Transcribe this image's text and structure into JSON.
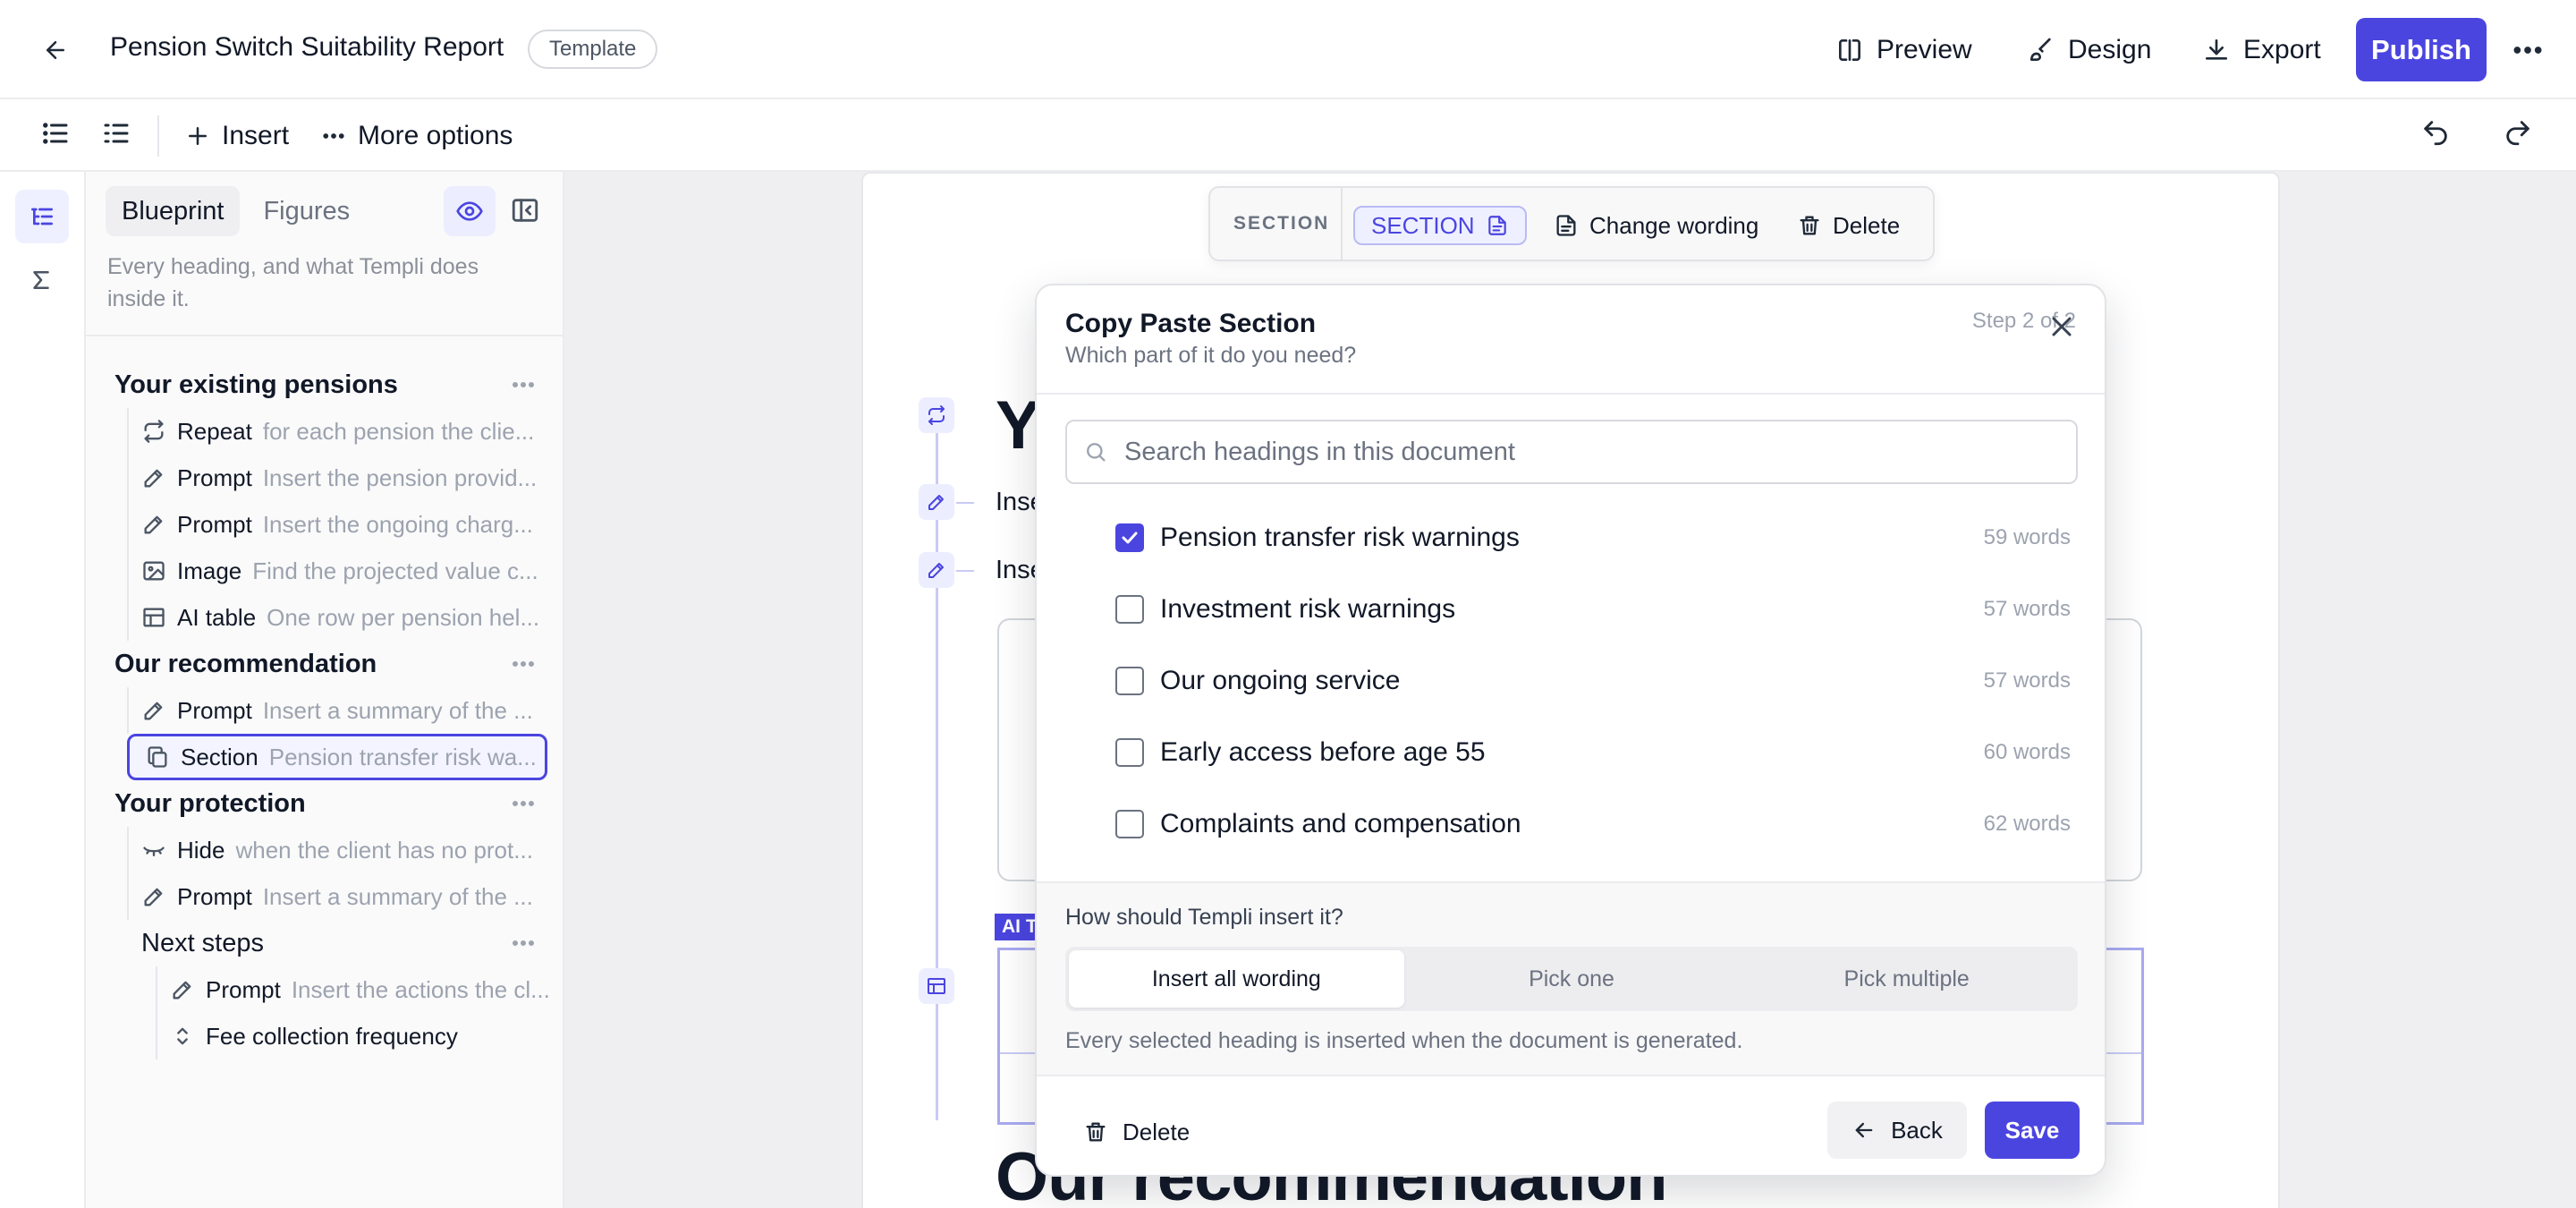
{
  "header": {
    "title": "Pension Switch Suitability Report",
    "badge": "Template",
    "actions": {
      "preview": "Preview",
      "design": "Design",
      "export": "Export",
      "publish": "Publish"
    }
  },
  "toolbar": {
    "insert": "Insert",
    "more_options": "More options"
  },
  "sidebar": {
    "tabs": [
      "Blueprint",
      "Figures"
    ],
    "description": "Every heading, and what Templi does inside it.",
    "sections": [
      {
        "title": "Your existing pensions",
        "blocks": [
          {
            "icon": "repeat-icon",
            "name": "Repeat",
            "desc": "for each pension the clie..."
          },
          {
            "icon": "pencil-icon",
            "name": "Prompt",
            "desc": "Insert the pension provid..."
          },
          {
            "icon": "pencil-icon",
            "name": "Prompt",
            "desc": "Insert the ongoing charg..."
          },
          {
            "icon": "image-icon",
            "name": "Image",
            "desc": "Find the projected value c..."
          },
          {
            "icon": "table-icon",
            "name": "AI table",
            "desc": "One row per pension hel..."
          }
        ]
      },
      {
        "title": "Our recommendation",
        "blocks": [
          {
            "icon": "pencil-icon",
            "name": "Prompt",
            "desc": "Insert a summary of the ..."
          },
          {
            "icon": "copy-icon",
            "name": "Section",
            "desc": "Pension transfer risk wa..."
          }
        ]
      },
      {
        "title": "Your protection",
        "blocks": [
          {
            "icon": "eye-closed-icon",
            "name": "Hide",
            "desc": "when the client has no prot..."
          },
          {
            "icon": "pencil-icon",
            "name": "Prompt",
            "desc": "Insert a summary of the ..."
          }
        ]
      },
      {
        "title": "Next steps",
        "blocks": [
          {
            "icon": "pencil-icon",
            "name": "Prompt",
            "desc": "Insert the actions the cl..."
          },
          {
            "icon": "chevron-updown-icon",
            "name": "Fee collection frequency",
            "desc": ""
          }
        ]
      }
    ]
  },
  "canvas": {
    "heading_top": "Yo",
    "line1": "Inse",
    "line2": "Inse",
    "ai_tag": "AI T",
    "heading_bottom": "Our recommendation",
    "section_toolbar": {
      "label": "SECTION",
      "pill": "SECTION",
      "change_wording": "Change wording",
      "delete": "Delete"
    }
  },
  "modal": {
    "title": "Copy Paste Section",
    "subtitle": "Which part of it do you need?",
    "step": "Step 2 of 2",
    "search_placeholder": "Search headings in this document",
    "options": [
      {
        "label": "Pension transfer risk warnings",
        "words": "59 words",
        "checked": true
      },
      {
        "label": "Investment risk warnings",
        "words": "57 words",
        "checked": false
      },
      {
        "label": "Our ongoing service",
        "words": "57 words",
        "checked": false
      },
      {
        "label": "Early access before age 55",
        "words": "60 words",
        "checked": false
      },
      {
        "label": "Complaints and compensation",
        "words": "62 words",
        "checked": false
      }
    ],
    "how_label": "How should Templi insert it?",
    "modes": [
      "Insert all wording",
      "Pick one",
      "Pick multiple"
    ],
    "selected_mode": "Insert all wording",
    "mode_hint": "Every selected heading is inserted when the document is generated.",
    "footer": {
      "delete": "Delete",
      "back": "Back",
      "save": "Save"
    }
  },
  "colors": {
    "accent": "#4b45e0",
    "accent_soft": "#eef0ff",
    "border": "#e5e7eb",
    "muted": "#9ca3af"
  }
}
